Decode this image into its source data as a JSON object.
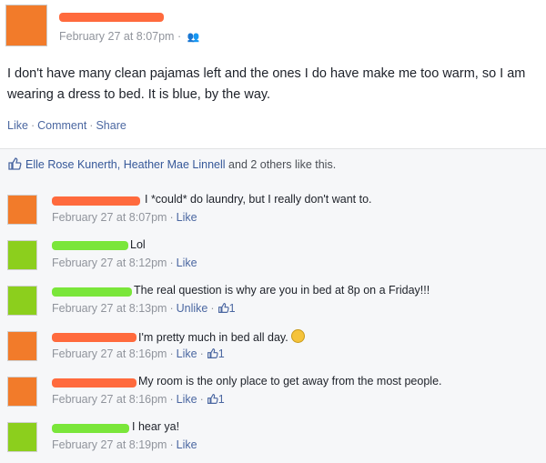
{
  "post": {
    "timestamp": "February 27 at 8:07pm",
    "separator": "·",
    "text": "I don't have many clean pajamas left and the ones I do have make me too warm, so I am wearing a dress to bed. It is blue, by the way.",
    "actions": [
      "Like",
      "Comment",
      "Share"
    ]
  },
  "likes": {
    "names": "Elle Rose Kunerth, Heather Mae Linnell",
    "rest": " and 2 others like this."
  },
  "comments": [
    {
      "text": "I *could* do laundry, but I really don't want to.",
      "time": "February 27 at 8:07pm",
      "action": "Like",
      "likes": ""
    },
    {
      "text": "Lol",
      "time": "February 27 at 8:12pm",
      "action": "Like",
      "likes": ""
    },
    {
      "text": "The real question is why are you in bed at 8p on a Friday!!!",
      "time": "February 27 at 8:13pm",
      "action": "Unlike",
      "likes": "1"
    },
    {
      "text": "I'm pretty much in bed all day.",
      "time": "February 27 at 8:16pm",
      "action": "Like",
      "likes": "1"
    },
    {
      "text": "My room is the only place to get away from the most people.",
      "time": "February 27 at 8:16pm",
      "action": "Like",
      "likes": "1"
    },
    {
      "text": "I hear ya!",
      "time": "February 27 at 8:19pm",
      "action": "Like",
      "likes": ""
    }
  ],
  "colors": {
    "link": "#4b67a1",
    "redact_orange": "#ff6a3d",
    "redact_green": "#7ae63a"
  },
  "icons": [
    "people-icon",
    "thumbs-up-icon",
    "smiley-emoji-icon"
  ]
}
